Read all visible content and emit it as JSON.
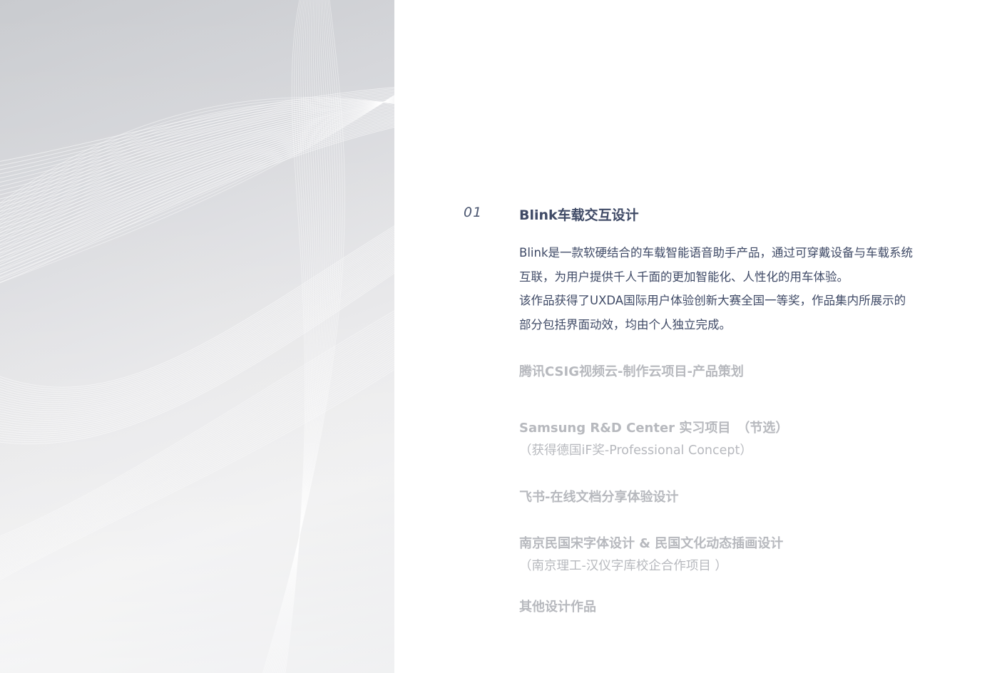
{
  "featured": {
    "number": "01",
    "title": "Blink车载交互设计",
    "description_lines": [
      "Blink是一款软硬结合的车载智能语音助手产品，通过可穿戴设备与车载系统",
      "互联，为用户提供千人千面的更加智能化、人性化的用车体验。",
      "该作品获得了UXDA国际用户体验创新大赛全国一等奖，作品集内所展示的",
      "部分包括界面动效，均由个人独立完成。"
    ]
  },
  "projects": [
    {
      "title": "腾讯CSIG视频云-制作云项目-产品策划",
      "subtitle": ""
    },
    {
      "title": "Samsung R&D Center 实习项目　（节选）",
      "subtitle": "（获得德国iF奖-Professional Concept）"
    },
    {
      "title": "飞书-在线文档分享体验设计",
      "subtitle": ""
    },
    {
      "title": "南京民国宋字体设计 & 民国文化动态插画设计",
      "subtitle": "（南京理工-汉仪字库校企合作项目 ）"
    },
    {
      "title": "其他设计作品",
      "subtitle": ""
    }
  ],
  "colors": {
    "active_text": "#3f4a66",
    "muted_text": "#b7b9be",
    "panel_bg": "#dcdde0",
    "line_color": "#ffffff"
  }
}
